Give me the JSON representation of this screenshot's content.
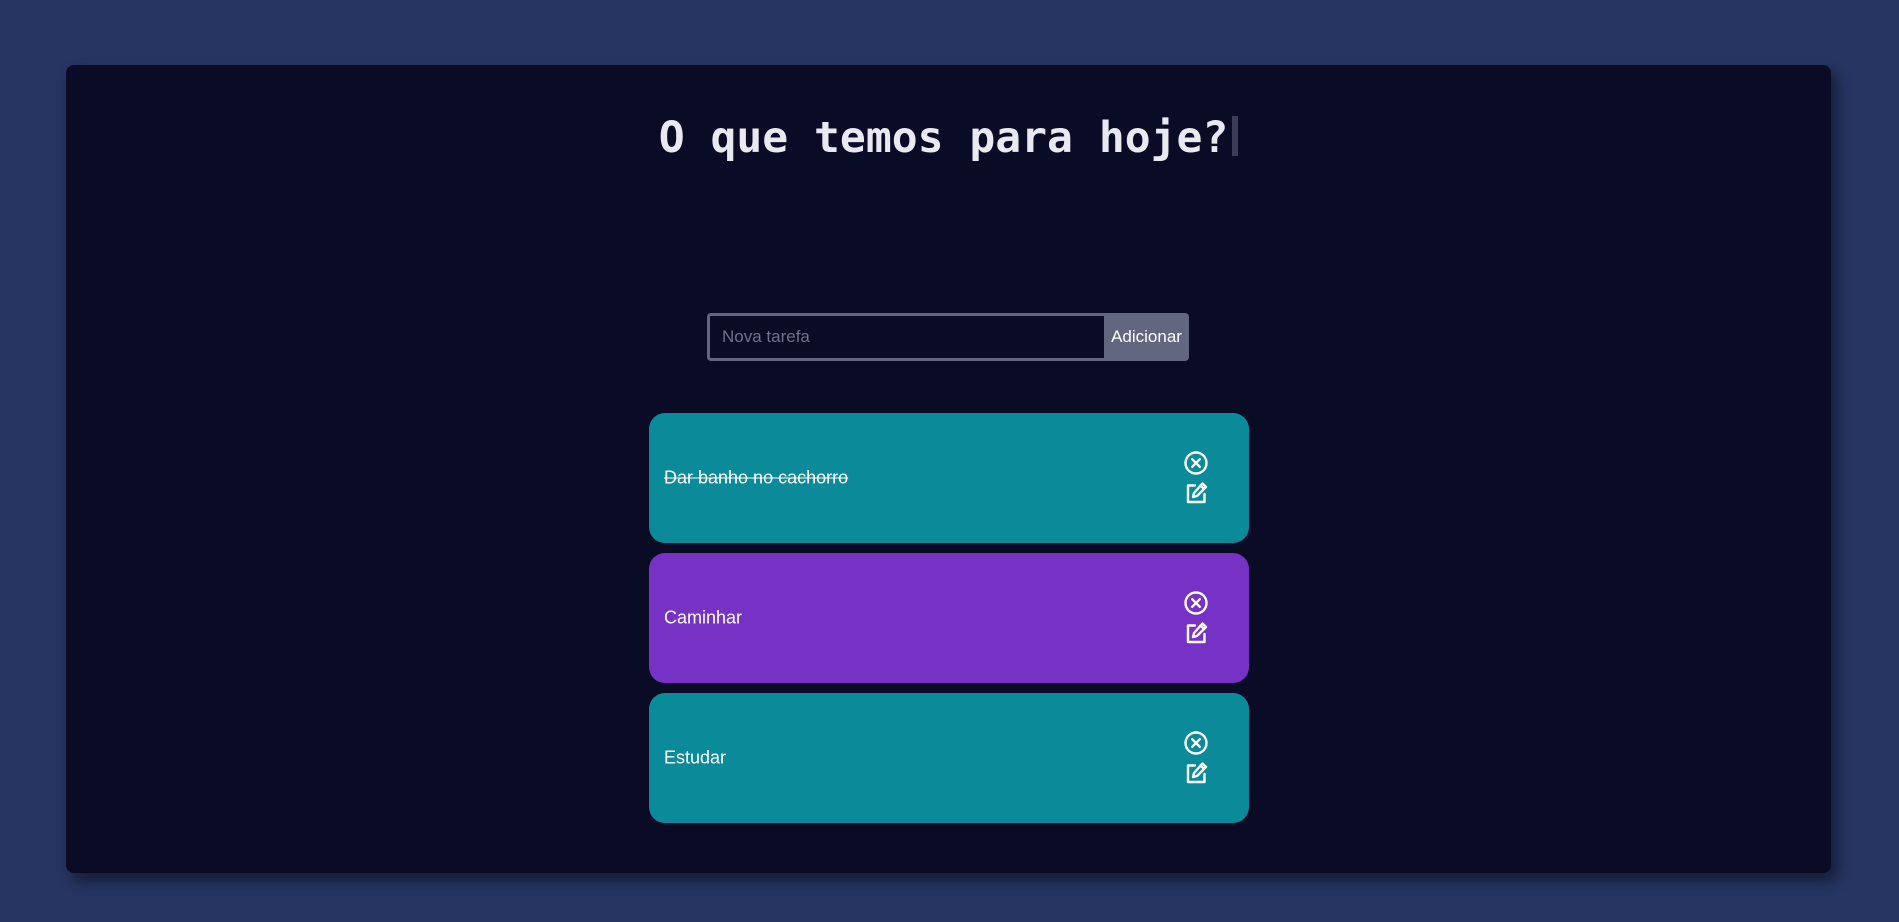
{
  "header": {
    "title": "O que temos para hoje?"
  },
  "form": {
    "input_placeholder": "Nova tarefa",
    "input_value": "",
    "add_label": "Adicionar"
  },
  "tasks": [
    {
      "label": "Dar banho no cachorro",
      "completed": true,
      "color": "#0b8a9a",
      "icons": [
        "close-circle-icon",
        "edit-icon"
      ]
    },
    {
      "label": "Caminhar",
      "completed": false,
      "color": "#7631c5",
      "icons": [
        "close-circle-icon",
        "edit-icon"
      ]
    },
    {
      "label": "Estudar",
      "completed": false,
      "color": "#0b8a9a",
      "icons": [
        "close-circle-icon",
        "edit-icon"
      ]
    }
  ],
  "colors": {
    "page_background": "#263562",
    "card_background": "#0a0c26",
    "title_text": "#e9e9f2",
    "input_border": "#62667f",
    "button_background": "#62667f",
    "teal_task": "#0b8a9a",
    "purple_task": "#7631c5"
  }
}
